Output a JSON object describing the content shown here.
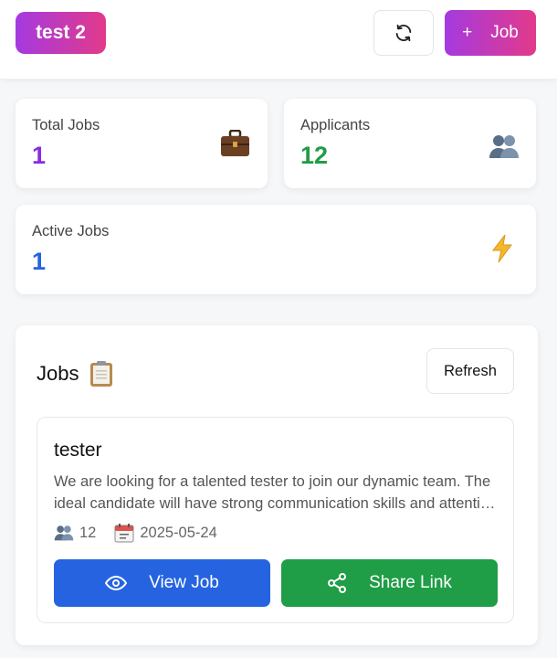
{
  "header": {
    "brand_label": "test 2",
    "add_job_plus": "+",
    "add_job_label": "Job"
  },
  "stats": {
    "total_jobs": {
      "label": "Total Jobs",
      "value": "1",
      "color": "#8a2be2",
      "icon": "briefcase-icon"
    },
    "applicants": {
      "label": "Applicants",
      "value": "12",
      "color": "#1f9d47",
      "icon": "people-icon"
    },
    "active_jobs": {
      "label": "Active Jobs",
      "value": "1",
      "color": "#2563e0",
      "icon": "lightning-icon"
    }
  },
  "jobs_panel": {
    "title": "Jobs",
    "title_icon": "clipboard-icon",
    "refresh_label": "Refresh",
    "jobs": [
      {
        "title": "tester",
        "description": "We are looking for a talented tester to join our dynamic team. The ideal candidate will have strong communication skills and attention to detail.",
        "applicants": "12",
        "date": "2025-05-24",
        "view_label": "View Job",
        "share_label": "Share Link"
      }
    ]
  },
  "colors": {
    "brand_gradient_start": "#a53ae0",
    "brand_gradient_end": "#e23a8a",
    "view_button": "#2563e0",
    "share_button": "#1f9d47"
  }
}
